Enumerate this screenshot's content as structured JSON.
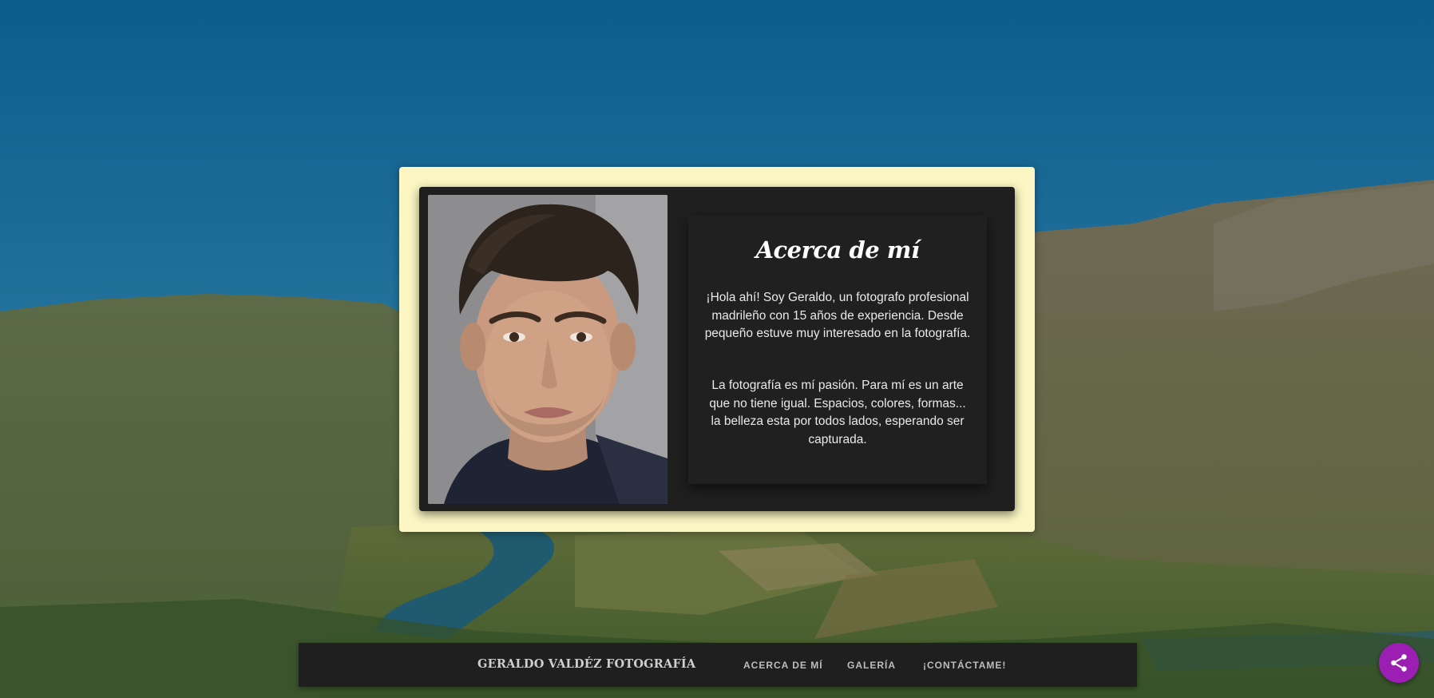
{
  "about": {
    "title": "Acerca de mí",
    "paragraph1": "¡Hola ahí! Soy Geraldo, un fotografo profesional madrileño con 15 años de experiencia. Desde pequeño estuve muy interesado en la fotografía.",
    "paragraph2": "La fotografía es mí pasión. Para mí es un arte que no tiene igual. Espacios, colores, formas... la belleza esta por todos lados, esperando ser capturada."
  },
  "nav": {
    "brand": "GERALDO VALDÉZ FOTOGRAFÍA",
    "links": [
      "ACERCA DE MÍ",
      "GALERÍA",
      "¡CONTÁCTAME!"
    ]
  },
  "colors": {
    "card_frame": "#fbf6c3",
    "panel": "#1f1f1f",
    "share_button": "#9c1fb4"
  },
  "icons": {
    "share": "share-icon"
  }
}
